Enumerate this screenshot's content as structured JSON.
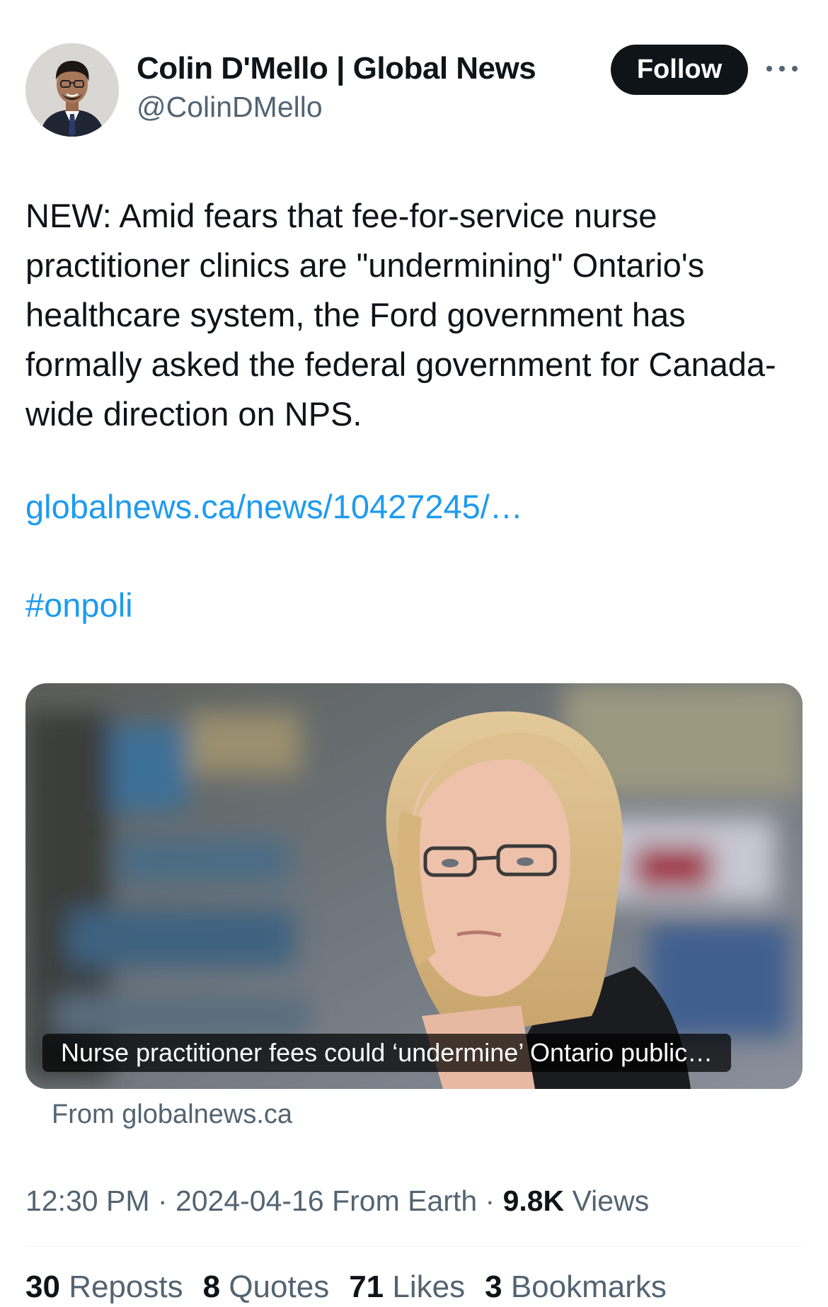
{
  "author": {
    "name": "Colin D'Mello | Global News",
    "handle": "@ColinDMello",
    "follow_label": "Follow"
  },
  "tweet": {
    "text": "NEW: Amid fears that fee-for-service nurse practitioner clinics are \"undermining\" Ontario's healthcare system, the Ford government has formally asked the federal government for Canada-wide direction on NPS.",
    "link": "globalnews.ca/news/10427245/…",
    "hashtag": "#onpoli"
  },
  "card": {
    "caption": "Nurse practitioner fees could ‘undermine’ Ontario public…",
    "source": "From globalnews.ca"
  },
  "meta": {
    "time": "12:30 PM",
    "date": "2024-04-16",
    "origin": "From Earth",
    "views_count": "9.8K",
    "views_label": "Views"
  },
  "stats": {
    "reposts_count": "30",
    "reposts_label": "Reposts",
    "quotes_count": "8",
    "quotes_label": "Quotes",
    "likes_count": "71",
    "likes_label": "Likes",
    "bookmarks_count": "3",
    "bookmarks_label": "Bookmarks"
  },
  "colors": {
    "link": "#1d9bf0",
    "secondary_text": "#536471",
    "primary_text": "#0f1419",
    "follow_button": "#0f1419"
  }
}
